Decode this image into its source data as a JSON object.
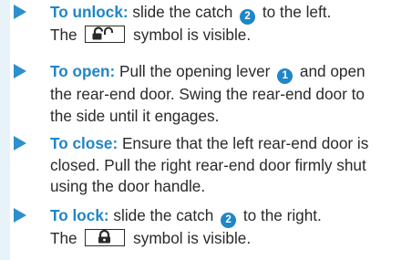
{
  "steps": [
    {
      "label": "To unlock:",
      "line1_text": " slide the catch ",
      "callout": "2",
      "line1_end": " to the left.",
      "line2_pre": "The ",
      "symbol_icon": "unlocked-padlock-icon",
      "line2_post": " symbol is visible."
    },
    {
      "label": "To open:",
      "line1_text": " Pull the opening lever ",
      "callout": "1",
      "line1_end": " and open",
      "line2": "the rear-end door. Swing the rear-end door to",
      "line3": "the side until it engages."
    },
    {
      "label": "To close:",
      "line1_text": " Ensure that the left rear-end door is",
      "line2": "closed. Pull the right rear-end door firmly shut",
      "line3": "using the door handle."
    },
    {
      "label": "To lock:",
      "line1_text": " slide the catch ",
      "callout": "2",
      "line1_end": " to the right.",
      "line2_pre": "The ",
      "symbol_icon": "locked-padlock-icon",
      "line2_post": " symbol is visible."
    }
  ],
  "colors": {
    "accent": "#1f86c7",
    "arrow": "#2d8fcb",
    "sidebar": "#e8f2f9",
    "text": "#2a2a2a"
  }
}
